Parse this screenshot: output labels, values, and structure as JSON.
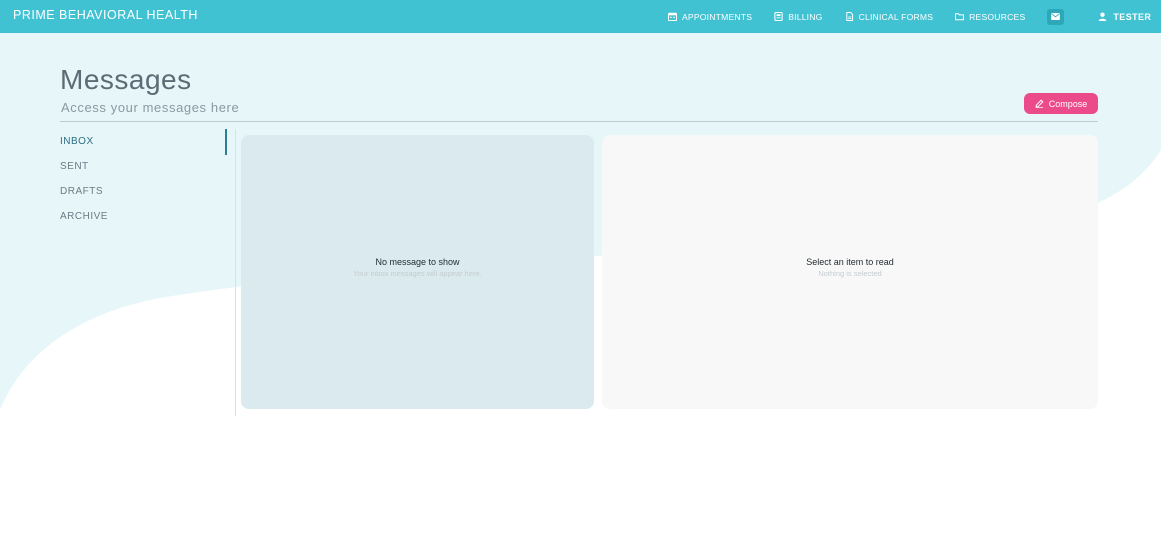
{
  "app": {
    "brand": "PRIME BEHAVIORAL HEALTH"
  },
  "nav": {
    "items": [
      {
        "label": "APPOINTMENTS",
        "icon": "calendar-icon"
      },
      {
        "label": "BILLING",
        "icon": "billing-icon"
      },
      {
        "label": "CLINICAL FORMS",
        "icon": "document-icon"
      },
      {
        "label": "RESOURCES",
        "icon": "folder-icon"
      }
    ],
    "mail_icon": "mail-icon",
    "user": {
      "label": "TESTER",
      "icon": "user-icon"
    },
    "logout_icon": "logout-icon"
  },
  "page": {
    "title": "Messages",
    "subtitle": "Access your messages here",
    "compose_label": "Compose"
  },
  "sidebar": {
    "items": [
      {
        "label": "INBOX",
        "active": true
      },
      {
        "label": "SENT",
        "active": false
      },
      {
        "label": "DRAFTS",
        "active": false
      },
      {
        "label": "ARCHIVE",
        "active": false
      }
    ]
  },
  "list_panel": {
    "empty_title": "No message to show",
    "empty_hint": "Your inbox messages will appear here."
  },
  "read_panel": {
    "empty_title": "Select an item to read",
    "empty_hint": "Nothing is selected"
  },
  "colors": {
    "topbar": "#41c2d3",
    "background_wave": "#e7f6f9",
    "compose": "#ec4b8b",
    "list_panel": "#dbeaee",
    "read_panel": "#f8f8f8"
  }
}
